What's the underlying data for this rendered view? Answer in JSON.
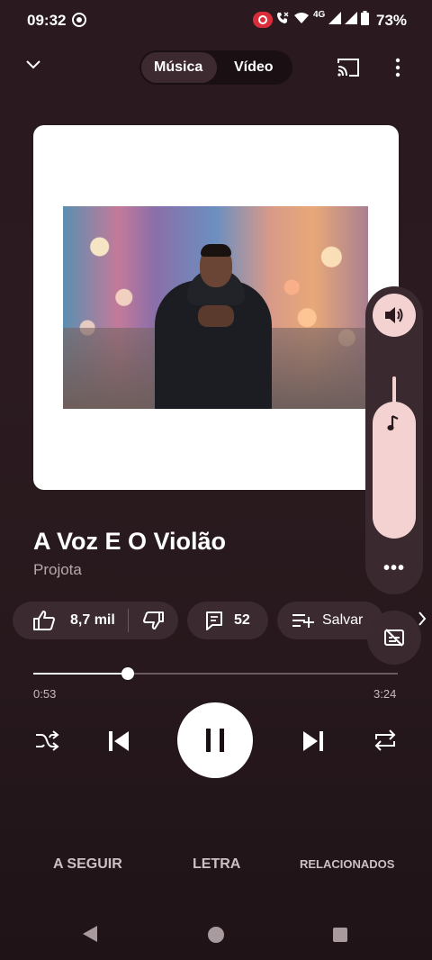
{
  "status_bar": {
    "time": "09:32",
    "network": "4G",
    "battery": "73%"
  },
  "header": {
    "tabs": [
      {
        "label": "Música",
        "active": true
      },
      {
        "label": "Vídeo",
        "active": false
      }
    ]
  },
  "song": {
    "title": "A Voz E O Violão",
    "artist": "Projota"
  },
  "actions": {
    "likes": "8,7 mil",
    "comments": "52",
    "save_label": "Salvar"
  },
  "progress": {
    "elapsed": "0:53",
    "duration": "3:24",
    "fraction": 0.26
  },
  "volume": {
    "level": 0.65
  },
  "bottom_tabs": [
    {
      "label": "A SEGUIR"
    },
    {
      "label": "LETRA"
    },
    {
      "label": "RELACIONADOS"
    }
  ],
  "colors": {
    "background": "#2a1a1f",
    "chip": "#3b2a30",
    "volume_accent": "#f4d2d2",
    "record_badge": "#d92e3a"
  }
}
